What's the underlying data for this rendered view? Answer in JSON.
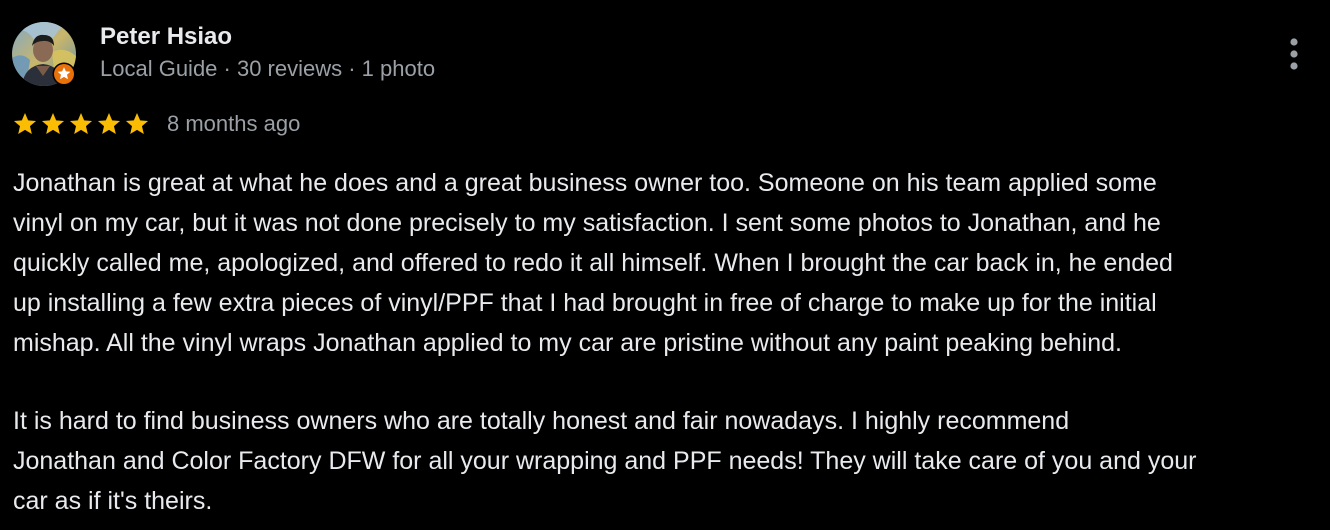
{
  "review": {
    "author": {
      "name": "Peter Hsiao",
      "meta": "Local Guide · 30 reviews · 1 photo",
      "avatar_icon": "profile-photo",
      "badge_icon": "local-guide-star-badge"
    },
    "more_icon": "more-vert-icon",
    "rating": {
      "stars": 5,
      "max": 5,
      "star_color": "#fbbc04",
      "date": "8 months ago"
    },
    "body": {
      "paragraph1": [
        "Jonathan is great at what he does and a great business owner too. Someone on his team applied some",
        "vinyl on my car, but it was not done precisely to my satisfaction. I sent some photos to Jonathan, and he",
        "quickly called me, apologized, and offered to redo it all himself. When I brought the car back in, he ended",
        "up installing a few extra pieces of vinyl/PPF that I had brought in free of charge to make up for the initial",
        "mishap. All the vinyl wraps Jonathan applied to my car are pristine without any paint peaking behind."
      ],
      "paragraph2": [
        "It is hard to find business owners who are totally honest and fair nowadays. I highly recommend",
        "Jonathan and Color Factory DFW for all your wrapping and PPF needs! They will take care of you and your",
        "car as if it's theirs."
      ]
    },
    "colors": {
      "background": "#000000",
      "primary_text": "#e8eaed",
      "secondary_text": "#9aa0a6",
      "badge_orange": "#e8710a"
    }
  }
}
